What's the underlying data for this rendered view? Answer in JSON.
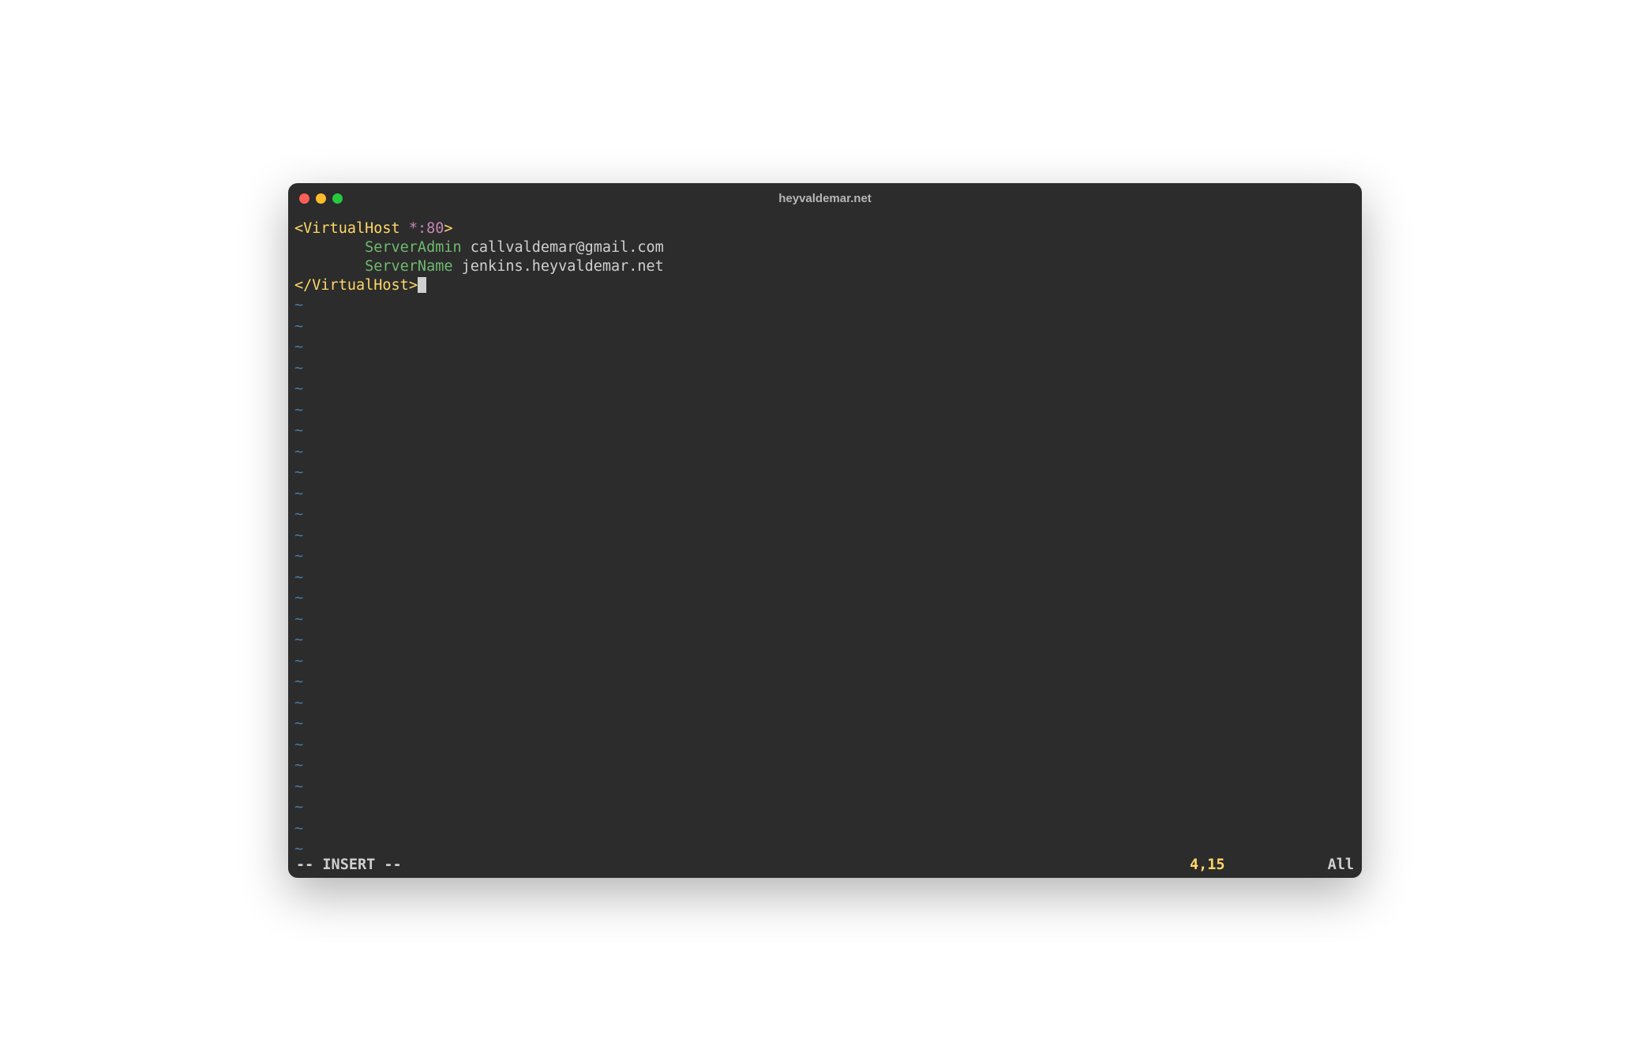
{
  "window": {
    "title": "heyvaldemar.net"
  },
  "code": {
    "line1": {
      "open_bracket": "<",
      "tag": "VirtualHost",
      "space": " ",
      "param": "*:80",
      "close_bracket": ">"
    },
    "line2": {
      "indent": "        ",
      "keyword": "ServerAdmin",
      "space": " ",
      "value": "callvaldemar@gmail.com"
    },
    "line3": {
      "indent": "        ",
      "keyword": "ServerName",
      "space": " ",
      "value": "jenkins.heyvaldemar.net"
    },
    "line4": {
      "open_bracket": "</",
      "tag": "VirtualHost",
      "close_bracket": ">"
    }
  },
  "tilde": "~",
  "status": {
    "mode": "-- INSERT --",
    "position": "4,15",
    "scroll": "All"
  },
  "tilde_count": 28
}
